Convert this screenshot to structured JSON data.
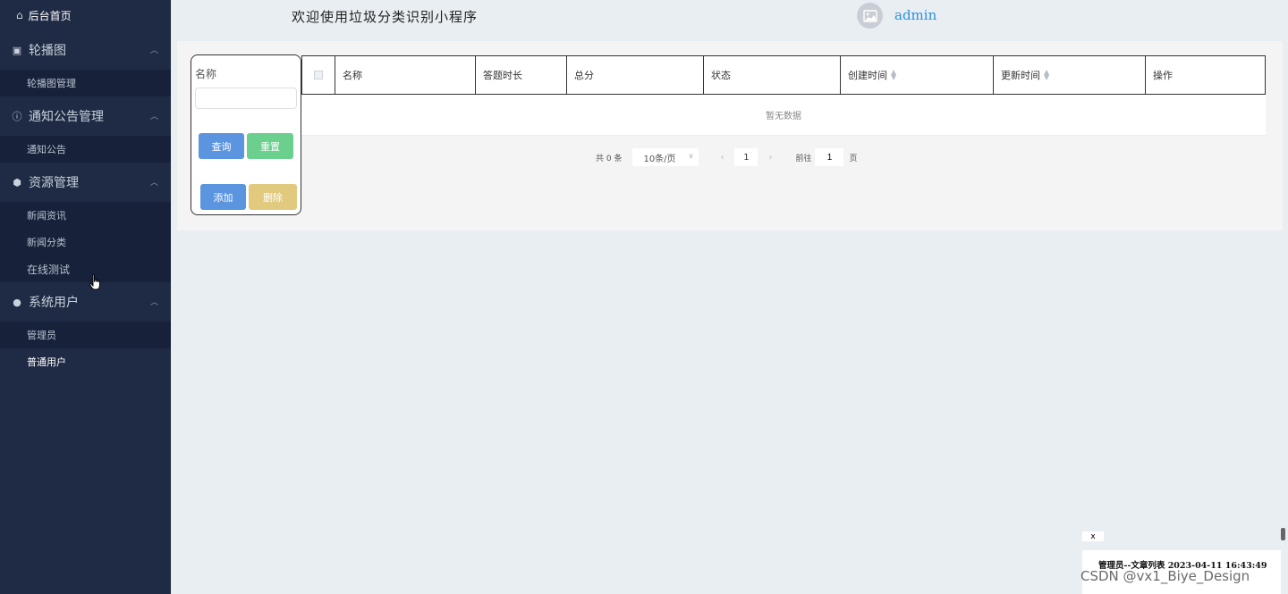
{
  "sidebar": {
    "home": "后台首页",
    "groups": [
      {
        "label": "轮播图",
        "items": [
          "轮播图管理"
        ]
      },
      {
        "label": "通知公告管理",
        "items": [
          "通知公告"
        ]
      },
      {
        "label": "资源管理",
        "items": [
          "新闻资讯",
          "新闻分类",
          "在线测试"
        ]
      },
      {
        "label": "系统用户",
        "items": [
          "管理员",
          "普通用户"
        ]
      }
    ]
  },
  "header": {
    "title": "欢迎使用垃圾分类识别小程序",
    "username": "admin"
  },
  "search": {
    "label": "名称",
    "value": "",
    "query_button": "查询",
    "reset_button": "重置",
    "add_button": "添加",
    "delete_button": "删除"
  },
  "table": {
    "columns": [
      "名称",
      "答题时长",
      "总分",
      "状态",
      "创建时间",
      "更新时间",
      "操作"
    ],
    "empty_text": "暂无数据"
  },
  "pagination": {
    "total_text": "共 0 条",
    "page_size": "10条/页",
    "current_page": "1",
    "goto_label": "前往",
    "goto_value": "1",
    "page_suffix": "页"
  },
  "overlay": {
    "close": "x",
    "notice": "管理员--文章列表 2023-04-11 16:43:49",
    "watermark": "CSDN @vx1_Biye_Design"
  }
}
